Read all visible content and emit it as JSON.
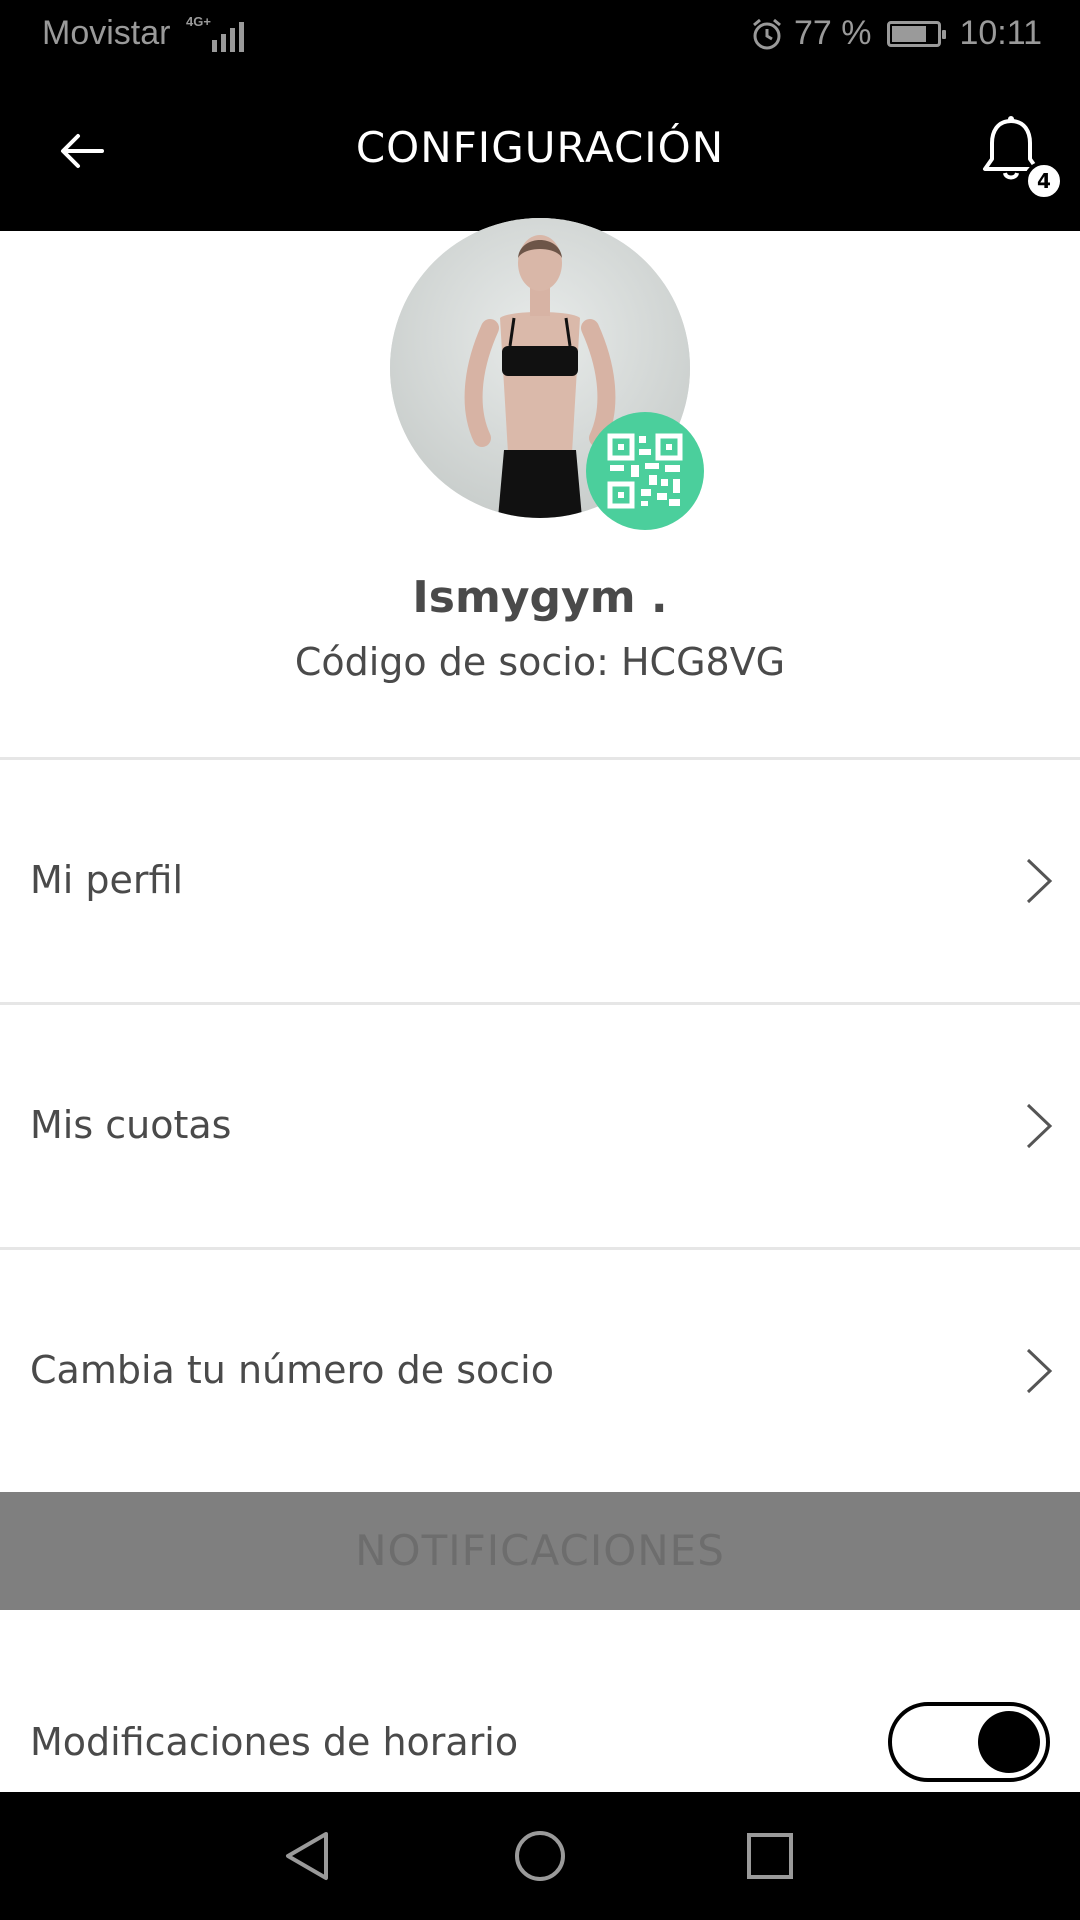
{
  "status_bar": {
    "carrier": "Movistar",
    "network": "4G+",
    "alarm_icon": "alarm-icon",
    "battery_percent": "77 %",
    "battery_level": 0.77,
    "time": "10:11"
  },
  "header": {
    "title": "CONFIGURACIÓN",
    "back_icon": "arrow-left-icon",
    "bell_icon": "bell-icon",
    "notification_count": "4"
  },
  "profile": {
    "name": "Ismygym .",
    "member_code": "Código de socio: HCG8VG",
    "qr_icon": "qr-code-icon",
    "colors": {
      "qr_badge": "#4bcf9c"
    }
  },
  "menu": {
    "items": [
      {
        "label": "Mi perfil"
      },
      {
        "label": "Mis cuotas"
      },
      {
        "label": "Cambia tu número de socio"
      }
    ]
  },
  "notifications": {
    "section_title": "NOTIFICACIONES",
    "toggle_label": "Modificaciones de horario",
    "toggle_on": true
  },
  "nav_bar": {
    "back_icon": "nav-back-icon",
    "home_icon": "nav-home-icon",
    "recents_icon": "nav-recents-icon"
  }
}
